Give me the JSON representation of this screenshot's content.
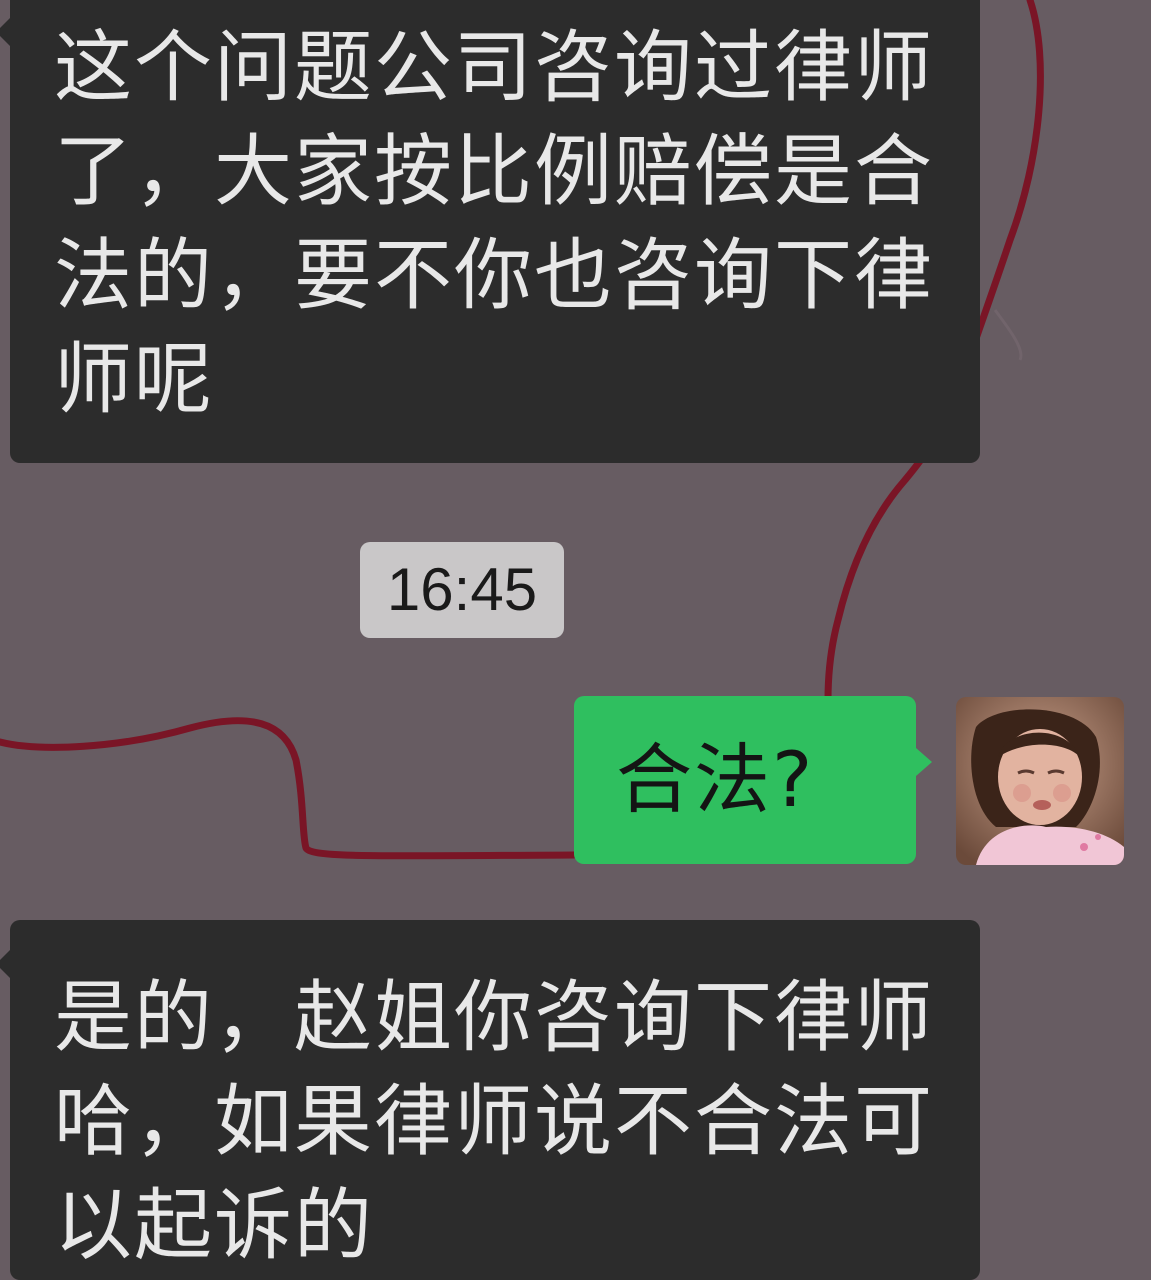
{
  "chat": {
    "messages": [
      {
        "direction": "incoming",
        "text": "这个问题公司咨询过律师了，大家按比例赔偿是合法的，要不你也咨询下律师呢"
      },
      {
        "direction": "outgoing",
        "text": "合法?"
      },
      {
        "direction": "incoming",
        "text": "是的，赵姐你咨询下律师哈，如果律师说不合法可以起诉的"
      }
    ],
    "timestamp": "16:45"
  },
  "theme": {
    "background": "#675c62",
    "incoming_bubble": "#2c2c2c",
    "outgoing_bubble": "#2fbf5f",
    "wallpaper_line": "#7a1526",
    "timestamp_bg": "#c9c7c8"
  },
  "icons": {
    "avatar": "user-avatar-photo"
  }
}
